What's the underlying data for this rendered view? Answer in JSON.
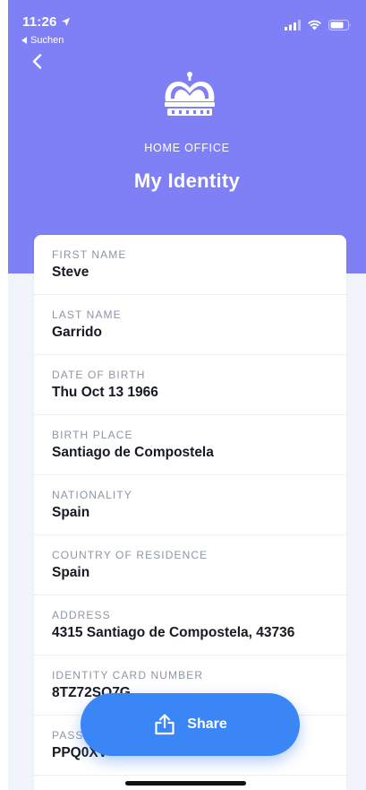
{
  "status_bar": {
    "time": "11:26",
    "back_app": "Suchen"
  },
  "header": {
    "org_name": "HOME OFFICE",
    "title": "My Identity"
  },
  "fields": [
    {
      "label": "FIRST NAME",
      "value": "Steve"
    },
    {
      "label": "LAST NAME",
      "value": "Garrido"
    },
    {
      "label": "DATE OF BIRTH",
      "value": "Thu Oct 13 1966"
    },
    {
      "label": "BIRTH PLACE",
      "value": "Santiago de Compostela"
    },
    {
      "label": "NATIONALITY",
      "value": "Spain"
    },
    {
      "label": "COUNTRY OF RESIDENCE",
      "value": "Spain"
    },
    {
      "label": "ADDRESS",
      "value": "4315 Santiago de Compostela, 43736"
    },
    {
      "label": "IDENTITY CARD NUMBER",
      "value": "8TZ72SO7G"
    },
    {
      "label": "PASS",
      "value": "PPQ0XV"
    }
  ],
  "share_button": {
    "label": "Share"
  },
  "colors": {
    "header": "#7f7ff6",
    "accent": "#3a86f7",
    "background": "#f1f5fb"
  },
  "icons": {
    "back": "chevron-left-icon",
    "logo": "crown-icon",
    "share": "share-upload-icon"
  }
}
